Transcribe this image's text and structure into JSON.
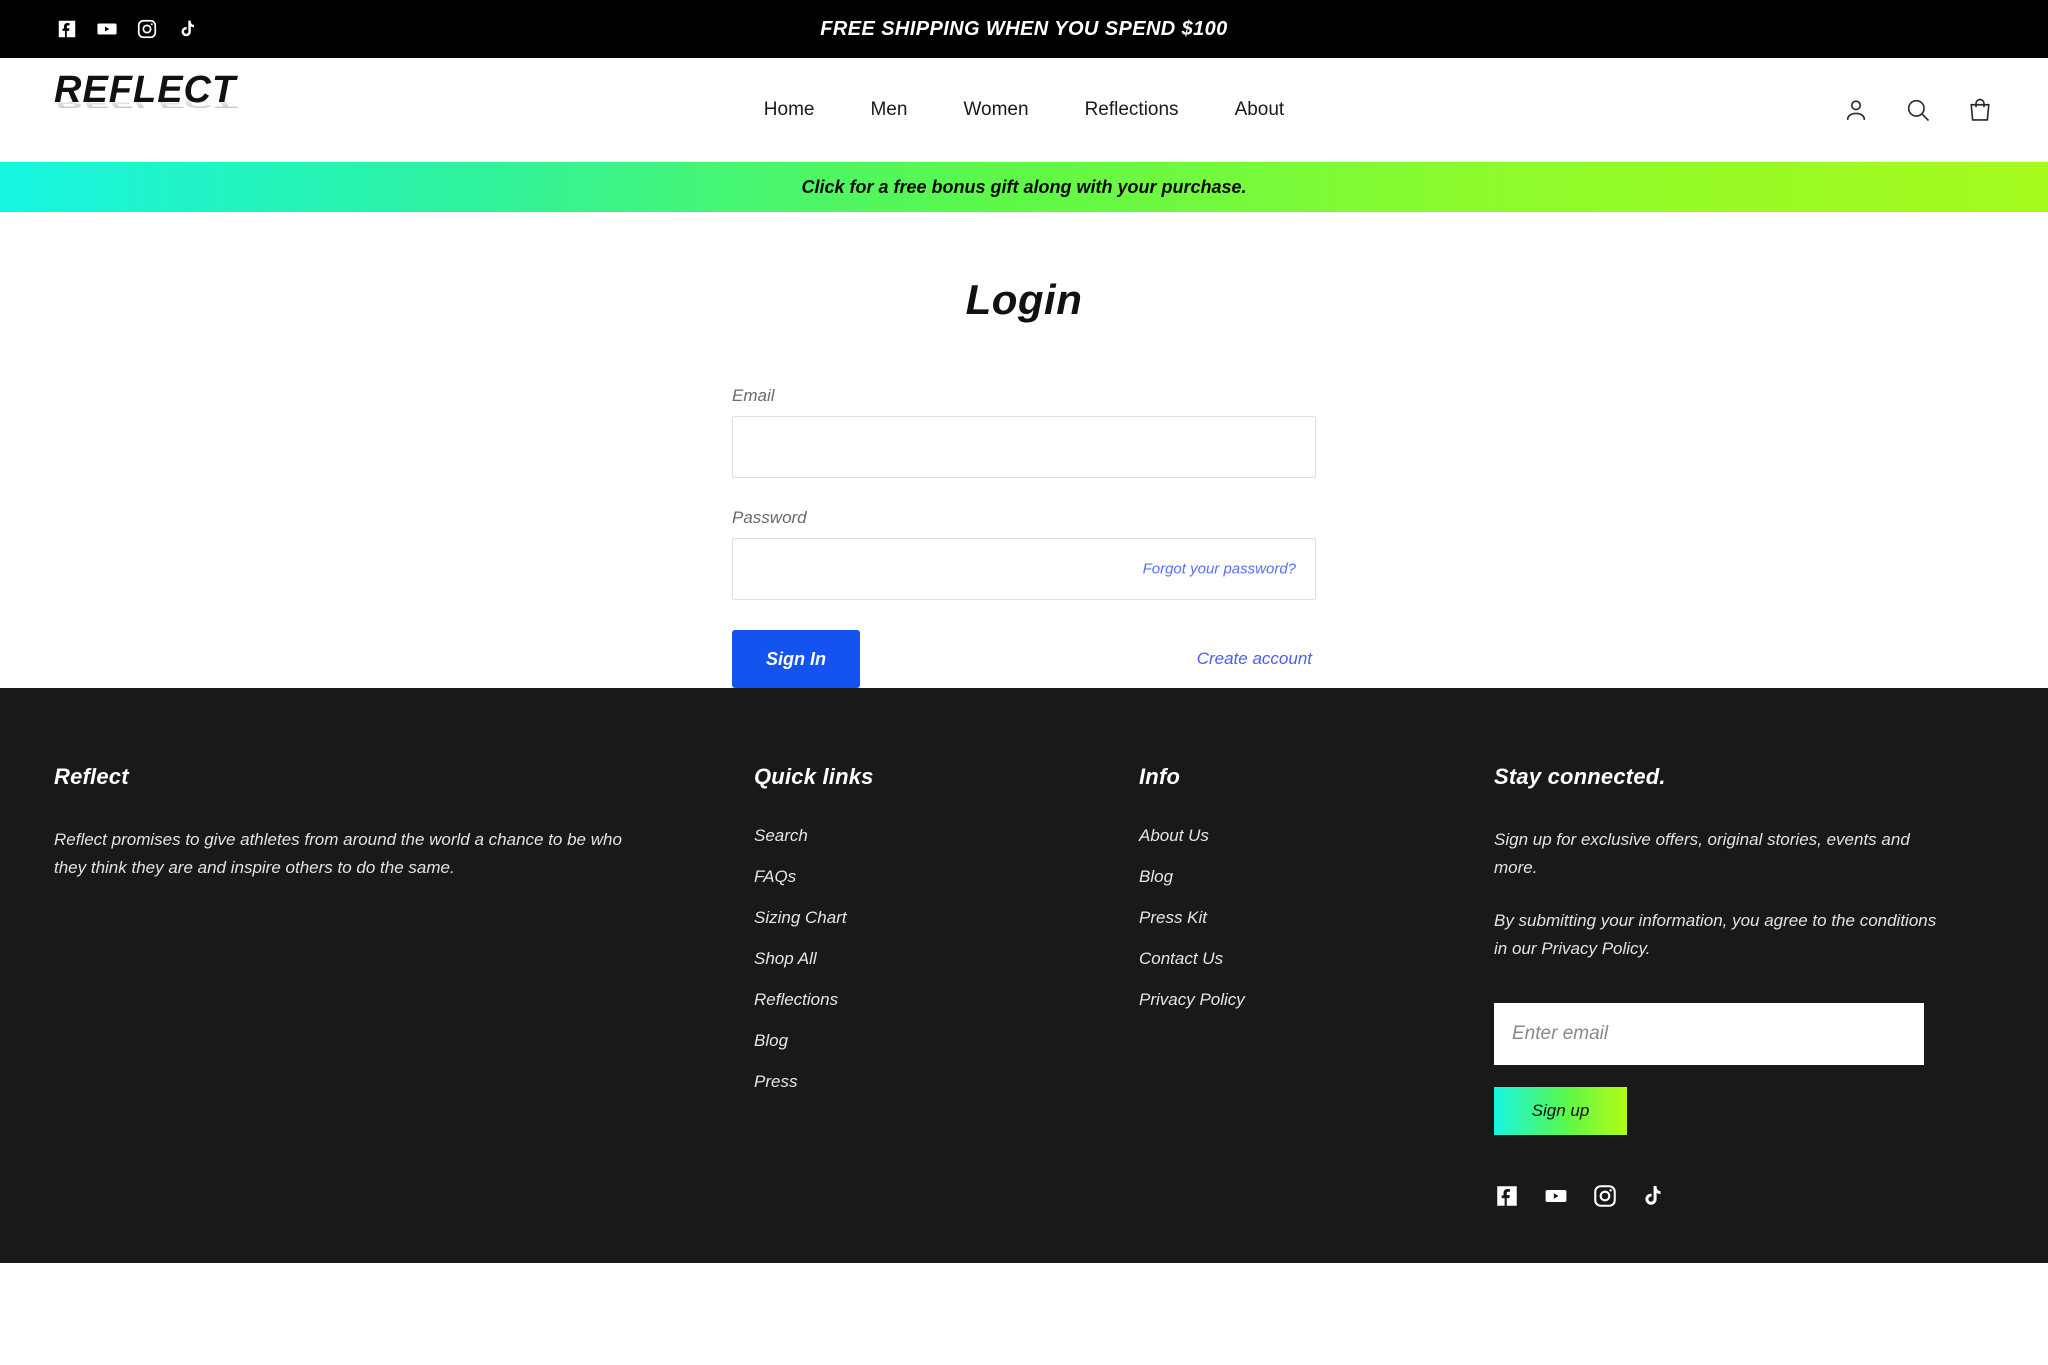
{
  "announcement": {
    "text": "FREE SHIPPING WHEN YOU SPEND $100",
    "social": [
      {
        "name": "facebook-icon",
        "label": "Facebook"
      },
      {
        "name": "youtube-icon",
        "label": "YouTube"
      },
      {
        "name": "instagram-icon",
        "label": "Instagram"
      },
      {
        "name": "tiktok-icon",
        "label": "TikTok"
      }
    ]
  },
  "header": {
    "logo": "REFLECT",
    "nav": [
      {
        "label": "Home"
      },
      {
        "label": "Men"
      },
      {
        "label": "Women"
      },
      {
        "label": "Reflections"
      },
      {
        "label": "About"
      }
    ],
    "icons": [
      {
        "name": "account-icon"
      },
      {
        "name": "search-icon"
      },
      {
        "name": "cart-icon"
      }
    ]
  },
  "promo": {
    "text": "Click for a free bonus gift along with your purchase.",
    "gradient_start": "#17f5e2",
    "gradient_end": "#a6fb1e"
  },
  "login": {
    "title": "Login",
    "email_label": "Email",
    "email_value": "",
    "email_placeholder": "",
    "password_label": "Password",
    "password_value": "",
    "password_placeholder": "",
    "forgot_link": "Forgot your password?",
    "submit_label": "Sign In",
    "create_account_label": "Create account",
    "submit_color": "#1553f0"
  },
  "footer": {
    "brand": {
      "heading": "Reflect",
      "body": "Reflect promises to give athletes from around the world a chance to be who they think they are and inspire others to do the same."
    },
    "quick_links": {
      "heading": "Quick links",
      "items": [
        {
          "label": "Search"
        },
        {
          "label": "FAQs"
        },
        {
          "label": "Sizing Chart"
        },
        {
          "label": "Shop All"
        },
        {
          "label": "Reflections"
        },
        {
          "label": "Blog"
        },
        {
          "label": "Press"
        }
      ]
    },
    "info": {
      "heading": "Info",
      "items": [
        {
          "label": "About Us"
        },
        {
          "label": "Blog"
        },
        {
          "label": "Press Kit"
        },
        {
          "label": "Contact Us"
        },
        {
          "label": "Privacy Policy"
        }
      ]
    },
    "stay": {
      "heading": "Stay connected.",
      "body1": "Sign up for exclusive offers, original stories, events and more.",
      "body2": "By submitting your information, you agree to the conditions in our Privacy Policy.",
      "email_value": "",
      "email_placeholder": "Enter email",
      "signup_label": "Sign up",
      "social": [
        {
          "name": "facebook-icon",
          "label": "Facebook"
        },
        {
          "name": "youtube-icon",
          "label": "YouTube"
        },
        {
          "name": "instagram-icon",
          "label": "Instagram"
        },
        {
          "name": "tiktok-icon",
          "label": "TikTok"
        }
      ]
    }
  }
}
